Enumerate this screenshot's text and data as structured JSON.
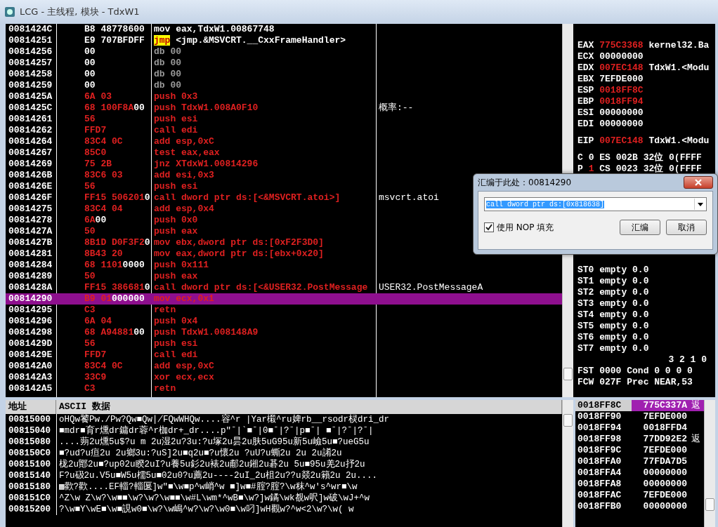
{
  "window": {
    "title": "LCG - 主线程, 模块 - TdxW1"
  },
  "disassembly": {
    "rows": [
      {
        "address": "0081424C",
        "hex": "B8 48778600",
        "kind": "code",
        "mnemonic": "mov",
        "operands": "eax,TdxW1.00867748",
        "modified": false,
        "selected": false,
        "highlighted": false
      },
      {
        "address": "00814251",
        "hex": "E9 707BFDFF",
        "kind": "code",
        "mnemonic": "jmp",
        "operands": "<jmp.&MSVCRT.__CxxFrameHandler>",
        "modified": false,
        "selected": false,
        "highlighted": true
      },
      {
        "address": "00814256",
        "hex": "00",
        "kind": "data",
        "mnemonic": "db",
        "operands": "00",
        "modified": false,
        "selected": false,
        "highlighted": false
      },
      {
        "address": "00814257",
        "hex": "00",
        "kind": "data",
        "mnemonic": "db",
        "operands": "00",
        "modified": false,
        "selected": false,
        "highlighted": false
      },
      {
        "address": "00814258",
        "hex": "00",
        "kind": "data",
        "mnemonic": "db",
        "operands": "00",
        "modified": false,
        "selected": false,
        "highlighted": false
      },
      {
        "address": "00814259",
        "hex": "00",
        "kind": "data",
        "mnemonic": "db",
        "operands": "00",
        "modified": false,
        "selected": false,
        "highlighted": false
      },
      {
        "address": "0081425A",
        "hex": "6A 03",
        "kind": "code",
        "mnemonic": "push",
        "operands": "0x3",
        "modified": true,
        "selected": false,
        "highlighted": false
      },
      {
        "address": "0081425C",
        "hex": "68 100F8A",
        "hex_tail": "00",
        "kind": "code",
        "mnemonic": "push",
        "operands": "TdxW1.008A0F10",
        "comment": "概率:--",
        "modified": true,
        "selected": false,
        "highlighted": false
      },
      {
        "address": "00814261",
        "hex": "56",
        "kind": "code",
        "mnemonic": "push",
        "operands": "esi",
        "modified": true,
        "selected": false,
        "highlighted": false
      },
      {
        "address": "00814262",
        "hex": "FFD7",
        "kind": "code",
        "mnemonic": "call",
        "operands": "edi",
        "modified": true,
        "selected": false,
        "highlighted": false
      },
      {
        "address": "00814264",
        "hex": "83C4 0C",
        "kind": "code",
        "mnemonic": "add",
        "operands": "esp,0xC",
        "modified": true,
        "selected": false,
        "highlighted": false
      },
      {
        "address": "00814267",
        "hex": "85C0",
        "kind": "code",
        "mnemonic": "test",
        "operands": "eax,eax",
        "modified": true,
        "selected": false,
        "highlighted": false
      },
      {
        "address": "00814269",
        "hex": "75 2B",
        "kind": "code",
        "mnemonic": "jnz",
        "operands": "XTdxW1.00814296",
        "modified": true,
        "selected": false,
        "highlighted": false
      },
      {
        "address": "0081426B",
        "hex": "83C6 03",
        "kind": "code",
        "mnemonic": "add",
        "operands": "esi,0x3",
        "modified": true,
        "selected": false,
        "highlighted": false
      },
      {
        "address": "0081426E",
        "hex": "56",
        "kind": "code",
        "mnemonic": "push",
        "operands": "esi",
        "modified": true,
        "selected": false,
        "highlighted": false
      },
      {
        "address": "0081426F",
        "hex": "FF15 506201",
        "hex_tail": "0",
        "kind": "code",
        "mnemonic": "call",
        "operands": "dword ptr ds:[<&MSVCRT.atoi>]",
        "comment": "msvcrt.atoi",
        "modified": true,
        "selected": false,
        "highlighted": false
      },
      {
        "address": "00814275",
        "hex": "83C4 04",
        "kind": "code",
        "mnemonic": "add",
        "operands": "esp,0x4",
        "modified": true,
        "selected": false,
        "highlighted": false
      },
      {
        "address": "00814278",
        "hex": "6A",
        "hex_tail": "00",
        "kind": "code",
        "mnemonic": "push",
        "operands": "0x0",
        "modified": true,
        "selected": false,
        "highlighted": false
      },
      {
        "address": "0081427A",
        "hex": "50",
        "kind": "code",
        "mnemonic": "push",
        "operands": "eax",
        "modified": true,
        "selected": false,
        "highlighted": false
      },
      {
        "address": "0081427B",
        "hex": "8B1D D0F3F2",
        "hex_tail": "0",
        "kind": "code",
        "mnemonic": "mov",
        "operands": "ebx,dword ptr ds:[0xF2F3D0]",
        "modified": true,
        "selected": false,
        "highlighted": false
      },
      {
        "address": "00814281",
        "hex": "8B43 20",
        "kind": "code",
        "mnemonic": "mov",
        "operands": "eax,dword ptr ds:[ebx+0x20]",
        "modified": true,
        "selected": false,
        "highlighted": false
      },
      {
        "address": "00814284",
        "hex": "68 1101",
        "hex_tail": "0000",
        "kind": "code",
        "mnemonic": "push",
        "operands": "0x111",
        "modified": true,
        "selected": false,
        "highlighted": false
      },
      {
        "address": "00814289",
        "hex": "50",
        "kind": "code",
        "mnemonic": "push",
        "operands": "eax",
        "modified": true,
        "selected": false,
        "highlighted": false
      },
      {
        "address": "0081428A",
        "hex": "FF15 386681",
        "hex_tail": "0",
        "kind": "code",
        "mnemonic": "call",
        "operands": "dword ptr ds:[<&USER32.PostMessage",
        "comment": "USER32.PostMessageA",
        "modified": true,
        "selected": false,
        "highlighted": false
      },
      {
        "address": "00814290",
        "hex": "B9 01",
        "hex_tail": "000000",
        "kind": "code",
        "mnemonic": "mov",
        "operands": "ecx,0x1",
        "modified": true,
        "selected": true,
        "highlighted": false
      },
      {
        "address": "00814295",
        "hex": "C3",
        "kind": "code",
        "mnemonic": "retn",
        "modified": true,
        "selected": false,
        "highlighted": false
      },
      {
        "address": "00814296",
        "hex": "6A 04",
        "kind": "code",
        "mnemonic": "push",
        "operands": "0x4",
        "modified": true,
        "selected": false,
        "highlighted": false
      },
      {
        "address": "00814298",
        "hex": "68 A94881",
        "hex_tail": "00",
        "kind": "code",
        "mnemonic": "push",
        "operands": "TdxW1.008148A9",
        "modified": true,
        "selected": false,
        "highlighted": false
      },
      {
        "address": "0081429D",
        "hex": "56",
        "kind": "code",
        "mnemonic": "push",
        "operands": "esi",
        "modified": true,
        "selected": false,
        "highlighted": false
      },
      {
        "address": "0081429E",
        "hex": "FFD7",
        "kind": "code",
        "mnemonic": "call",
        "operands": "edi",
        "modified": true,
        "selected": false,
        "highlighted": false
      },
      {
        "address": "008142A0",
        "hex": "83C4 0C",
        "kind": "code",
        "mnemonic": "add",
        "operands": "esp,0xC",
        "modified": true,
        "selected": false,
        "highlighted": false
      },
      {
        "address": "008142A3",
        "hex": "33C9",
        "kind": "code",
        "mnemonic": "xor",
        "operands": "ecx,ecx",
        "modified": true,
        "selected": false,
        "highlighted": false
      },
      {
        "address": "008142A5",
        "hex": "C3",
        "kind": "code",
        "mnemonic": "retn",
        "modified": true,
        "selected": false,
        "highlighted": false
      }
    ]
  },
  "registers": [
    {
      "kind": "reg",
      "name": "EAX",
      "value": "775C3368",
      "changed": true,
      "rest": "kernel32.Ba"
    },
    {
      "kind": "reg",
      "name": "ECX",
      "value": "00000000",
      "changed": false
    },
    {
      "kind": "reg",
      "name": "EDX",
      "value": "007EC148",
      "changed": true,
      "rest": "TdxW1.<Modu"
    },
    {
      "kind": "reg",
      "name": "EBX",
      "value": "7EFDE000",
      "changed": false
    },
    {
      "kind": "reg",
      "name": "ESP",
      "value": "0018FF8C",
      "changed": true
    },
    {
      "kind": "reg",
      "name": "EBP",
      "value": "0018FF94",
      "changed": true
    },
    {
      "kind": "reg",
      "name": "ESI",
      "value": "00000000",
      "changed": false
    },
    {
      "kind": "reg",
      "name": "EDI",
      "value": "00000000",
      "changed": false
    },
    {
      "kind": "gap"
    },
    {
      "kind": "reg",
      "name": "EIP",
      "value": "007EC148",
      "changed": true,
      "rest": "TdxW1.<Modu"
    },
    {
      "kind": "gap"
    },
    {
      "kind": "flag",
      "name": "C",
      "value": "0",
      "changed": false,
      "rest": "ES 002B 32位 0(FFFF"
    },
    {
      "kind": "flag",
      "name": "P",
      "value": "1",
      "changed": true,
      "rest": "CS 0023 32位 0(FFFF"
    },
    {
      "kind": "hidden"
    },
    {
      "kind": "hidden"
    },
    {
      "kind": "hidden"
    },
    {
      "kind": "hidden"
    },
    {
      "kind": "hidden"
    },
    {
      "kind": "hidden"
    },
    {
      "kind": "hidden"
    },
    {
      "kind": "hidden"
    },
    {
      "kind": "reg",
      "name": "ST0",
      "value": "empty",
      "changed": false,
      "rest": "0.0"
    },
    {
      "kind": "reg",
      "name": "ST1",
      "value": "empty",
      "changed": false,
      "rest": "0.0"
    },
    {
      "kind": "reg",
      "name": "ST2",
      "value": "empty",
      "changed": false,
      "rest": "0.0"
    },
    {
      "kind": "reg",
      "name": "ST3",
      "value": "empty",
      "changed": false,
      "rest": "0.0"
    },
    {
      "kind": "reg",
      "name": "ST4",
      "value": "empty",
      "changed": false,
      "rest": "0.0"
    },
    {
      "kind": "reg",
      "name": "ST5",
      "value": "empty",
      "changed": false,
      "rest": "0.0"
    },
    {
      "kind": "reg",
      "name": "ST6",
      "value": "empty",
      "changed": false,
      "rest": "0.0"
    },
    {
      "kind": "reg",
      "name": "ST7",
      "value": "empty",
      "changed": false,
      "rest": "0.0"
    },
    {
      "kind": "bits",
      "text": "3 2 1 0"
    },
    {
      "kind": "reg",
      "name": "FST",
      "value": "0000",
      "changed": false,
      "rest": "Cond 0 0 0 0"
    },
    {
      "kind": "reg",
      "name": "FCW",
      "value": "027F",
      "changed": false,
      "rest": "Prec NEAR,53"
    }
  ],
  "dump": {
    "columns": [
      "地址",
      "ASCII 数据"
    ],
    "rows": [
      {
        "address": "00815000",
        "ascii": "oHQw饕Pw./Pw?Qw■Qw∤FQwWHQw....容^r |Yar樧^ru婢rb__rsodr棂dri_dr"
      },
      {
        "address": "00815040",
        "ascii": "■mdr■育r燻dr鏞dr蓉^r枷dr+_dr....p\"ˉ|`■ˉ|0■ˉ|?ˉ|p■ˉ| ■ˉ|?ˉ|?ˉ|"
      },
      {
        "address": "00815080",
        "ascii": "....蒴2u燻5u$?u m 2u湿2u?3u:?u塚2u昙2u肤5uG95u新5u嶮5u■?ueG5u"
      },
      {
        "address": "008150C0",
        "ascii": "■?ud?u疸2u  2u鄉3u:?uS]2u■q2u■?u懷2u ?uU?u蟖2u  2u  2u誵2u"
      },
      {
        "address": "00815100",
        "ascii": "栊2u鄮2u■?up02u睽2uI?u養5u釤2u裱2u郙2u鎺2u碁2u  5u■95u羌2u抒2u"
      },
      {
        "address": "00815140",
        "ascii": "F?u砐2u.V5u■W5u檽5u■02u0?u薦2u----2uI_2u柤2u??u燚2u籟2u  2u...."
      },
      {
        "address": "00815180",
        "ascii": "▩歡?歡....EF輜?輜匽]w\"■\\w■p^w峭^w ■]w■#腟?腟?\\w秣^w's^wr■\\w"
      },
      {
        "address": "008151C0",
        "ascii": "^Z\\w Z\\w?\\w■■\\w?\\w?\\w■■\\w#L\\wm*^wB■\\w?]w鐍\\wk覩w呎]w破\\wJ+^w"
      },
      {
        "address": "00815200",
        "ascii": "?\\w■Y\\wE■\\w■誢w0■\\w?\\w嶋^w?\\w?\\w0■\\w叼]wH觀w?^w<2\\w?\\w(  w"
      }
    ]
  },
  "stack": {
    "rows": [
      {
        "address": "0018FF8C",
        "value": "775C337A",
        "comment": "返",
        "selected": true
      },
      {
        "address": "0018FF90",
        "value": "7EFDE000",
        "selected": false
      },
      {
        "address": "0018FF94",
        "value": "0018FFD4",
        "selected": false
      },
      {
        "address": "0018FF98",
        "value": "77DD92E2",
        "comment": "返",
        "selected": false
      },
      {
        "address": "0018FF9C",
        "value": "7EFDE000",
        "selected": false
      },
      {
        "address": "0018FFA0",
        "value": "77FDA7D5",
        "selected": false
      },
      {
        "address": "0018FFA4",
        "value": "00000000",
        "selected": false
      },
      {
        "address": "0018FFA8",
        "value": "00000000",
        "selected": false
      },
      {
        "address": "0018FFAC",
        "value": "7EFDE000",
        "selected": false
      },
      {
        "address": "0018FFB0",
        "value": "00000000",
        "selected": false
      }
    ]
  },
  "dialog": {
    "title": "汇编于此处：00814290",
    "input": {
      "value": "call dword ptr ds:[0x818638]",
      "selected": true
    },
    "checkbox": {
      "label": "使用 NOP 填充",
      "checked": true
    },
    "buttons": [
      "汇编",
      "取消"
    ]
  }
}
